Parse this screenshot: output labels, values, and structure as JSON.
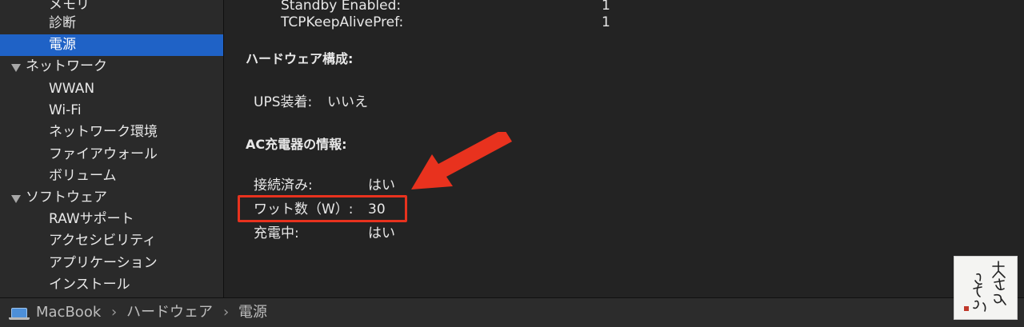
{
  "sidebar": {
    "items": [
      {
        "label": "メモリ"
      },
      {
        "label": "診断"
      },
      {
        "label": "電源"
      },
      {
        "label": "ネットワーク"
      },
      {
        "label": "WWAN"
      },
      {
        "label": "Wi-Fi"
      },
      {
        "label": "ネットワーク環境"
      },
      {
        "label": "ファイアウォール"
      },
      {
        "label": "ボリューム"
      },
      {
        "label": "ソフトウェア"
      },
      {
        "label": "RAWサポート"
      },
      {
        "label": "アクセシビリティ"
      },
      {
        "label": "アプリケーション"
      },
      {
        "label": "インストール"
      }
    ]
  },
  "content": {
    "standby_label": "Standby Enabled:",
    "standby_value": "1",
    "tcp_label": "TCPKeepAlivePref:",
    "tcp_value": "1",
    "hardware_header": "ハードウェア構成:",
    "ups_label": "UPS装着:",
    "ups_value": "いいえ",
    "ac_header": "AC充電器の情報:",
    "connected_label": "接続済み:",
    "connected_value": "はい",
    "wattage_label": "ワット数（W）:",
    "wattage_value": "30",
    "charging_label": "充電中:",
    "charging_value": "はい"
  },
  "pathbar": {
    "crumbs": [
      "MacBook",
      "ハードウェア",
      "電源"
    ],
    "separator": "›"
  },
  "colors": {
    "selection": "#1f62c6",
    "annotation_red": "#e8321e"
  },
  "watermark": {
    "text": "大きなひとりごと"
  }
}
